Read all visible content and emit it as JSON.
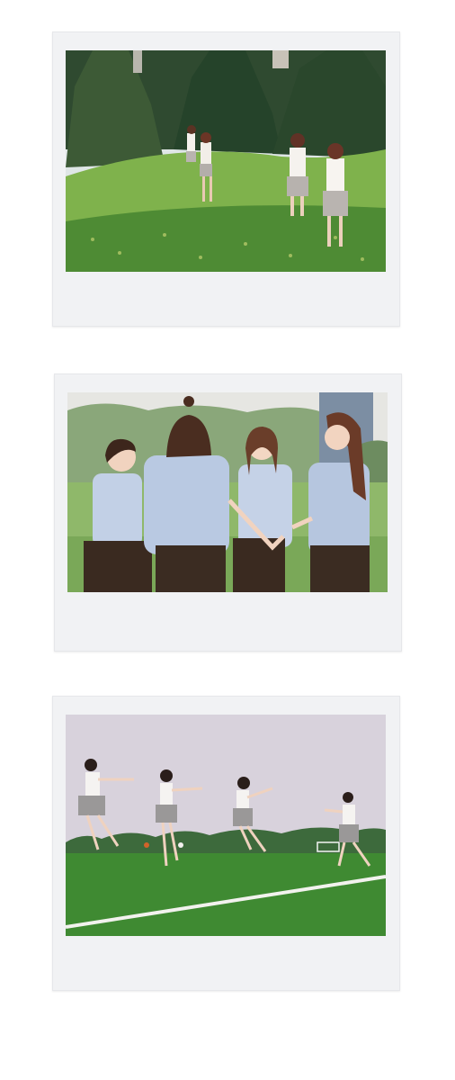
{
  "photos": [
    {
      "id": "photo-1",
      "scene": "girls-walking-on-grassy-hill"
    },
    {
      "id": "photo-2",
      "scene": "girls-holding-hands-in-circle"
    },
    {
      "id": "photo-3",
      "scene": "girls-running-on-soccer-field"
    }
  ],
  "colors": {
    "page_background": "#ffffff",
    "frame": "#f1f2f4",
    "grass": "#5f9c3a",
    "sky": "#d6d0dc",
    "shirt": "#b9c8e0",
    "skirt_dark": "#3b2c22"
  }
}
